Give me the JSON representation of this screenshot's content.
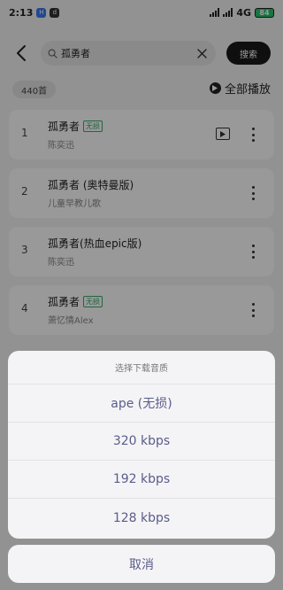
{
  "status_bar": {
    "time": "2:13",
    "notif1": "H",
    "notif2": "d",
    "network": "4G",
    "battery": "84"
  },
  "search": {
    "query": "孤勇者",
    "button_label": "搜索"
  },
  "results": {
    "count_label": "440首",
    "play_all_label": "全部播放"
  },
  "songs": [
    {
      "num": "1",
      "title": "孤勇者",
      "tag": "无损",
      "artist": "陈奕迅"
    },
    {
      "num": "2",
      "title": "孤勇者 (奥特曼版)",
      "artist": "儿童早教儿歌"
    },
    {
      "num": "3",
      "title": "孤勇者(热血epic版)",
      "artist": "陈奕迅"
    },
    {
      "num": "4",
      "title": "孤勇者",
      "tag": "无损",
      "artist": "萧忆情Alex"
    }
  ],
  "sheet": {
    "title": "选择下载音质",
    "options": [
      "ape (无损)",
      "320 kbps",
      "192 kbps",
      "128 kbps"
    ],
    "cancel_label": "取消"
  },
  "colors": {
    "accent_text": "#5a5c8a",
    "lossless_tag": "#3aa86b",
    "search_button_bg": "#1a1a1a"
  }
}
